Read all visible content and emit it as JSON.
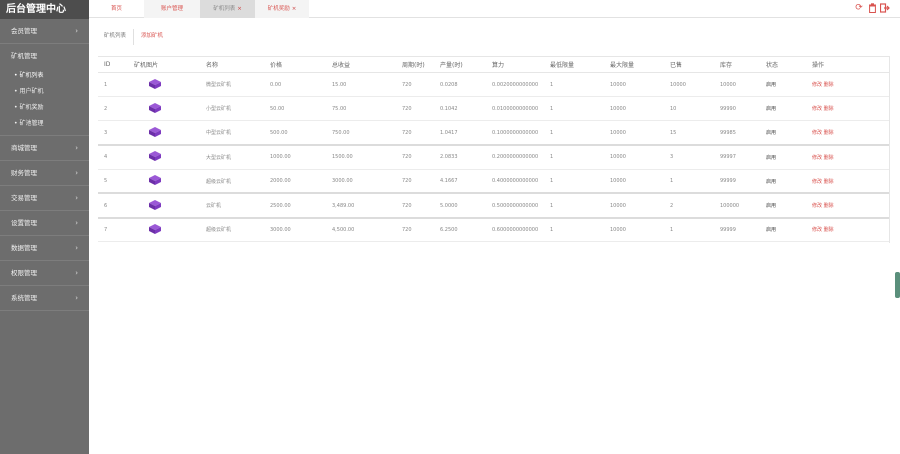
{
  "app": {
    "title": "后台管理中心"
  },
  "sidebar": {
    "groups": [
      {
        "label": "会员管理",
        "expanded": false
      },
      {
        "label": "矿机管理",
        "expanded": true,
        "items": [
          {
            "label": "矿机列表"
          },
          {
            "label": "用户矿机"
          },
          {
            "label": "矿机奖励"
          },
          {
            "label": "矿池管理"
          }
        ]
      },
      {
        "label": "商城管理",
        "expanded": false
      },
      {
        "label": "财务管理",
        "expanded": false
      },
      {
        "label": "交易管理",
        "expanded": false
      },
      {
        "label": "设置管理",
        "expanded": false
      },
      {
        "label": "数据管理",
        "expanded": false
      },
      {
        "label": "权限管理",
        "expanded": false
      },
      {
        "label": "系统管理",
        "expanded": false
      }
    ]
  },
  "topbar": {
    "tabs": [
      {
        "label": "首页"
      },
      {
        "label": "账户管理"
      },
      {
        "label": "矿机列表",
        "close": "×"
      },
      {
        "label": "矿机奖励",
        "close": "×"
      }
    ]
  },
  "subtabs": {
    "list": "矿机列表",
    "add": "添加矿机"
  },
  "table": {
    "headers": [
      "ID",
      "矿机图片",
      "名称",
      "价格",
      "总收益",
      "周期(时)",
      "产量(时)",
      "算力",
      "最低限量",
      "最大限量",
      "已售",
      "库存",
      "状态",
      "操作"
    ],
    "rows": [
      {
        "id": "1",
        "name": "微型云矿机",
        "price": "0.00",
        "revenue": "15.00",
        "cycle": "720",
        "output": "0.0208",
        "power": "0.0020000000000",
        "min": "1",
        "max": "10000",
        "sold": "10000",
        "stock": "10000",
        "status": "启用",
        "action": "修改 删除"
      },
      {
        "id": "2",
        "name": "小型云矿机",
        "price": "50.00",
        "revenue": "75.00",
        "cycle": "720",
        "output": "0.1042",
        "power": "0.0100000000000",
        "min": "1",
        "max": "10000",
        "sold": "10",
        "stock": "99990",
        "status": "启用",
        "action": "修改 删除"
      },
      {
        "id": "3",
        "name": "中型云矿机",
        "price": "500.00",
        "revenue": "750.00",
        "cycle": "720",
        "output": "1.0417",
        "power": "0.1000000000000",
        "min": "1",
        "max": "10000",
        "sold": "15",
        "stock": "99985",
        "status": "启用",
        "action": "修改 删除"
      },
      {
        "id": "4",
        "name": "大型云矿机",
        "price": "1000.00",
        "revenue": "1500.00",
        "cycle": "720",
        "output": "2.0833",
        "power": "0.2000000000000",
        "min": "1",
        "max": "10000",
        "sold": "3",
        "stock": "99997",
        "status": "启用",
        "action": "修改 删除"
      },
      {
        "id": "5",
        "name": "超级云矿机",
        "price": "2000.00",
        "revenue": "3000.00",
        "cycle": "720",
        "output": "4.1667",
        "power": "0.4000000000000",
        "min": "1",
        "max": "10000",
        "sold": "1",
        "stock": "99999",
        "status": "启用",
        "action": "修改 删除"
      },
      {
        "id": "6",
        "name": "云矿机",
        "price": "2500.00",
        "revenue": "3,489.00",
        "cycle": "720",
        "output": "5.0000",
        "power": "0.5000000000000",
        "min": "1",
        "max": "10000",
        "sold": "2",
        "stock": "100000",
        "status": "启用",
        "action": "修改 删除"
      },
      {
        "id": "7",
        "name": "超级云矿机",
        "price": "3000.00",
        "revenue": "4,500.00",
        "cycle": "720",
        "output": "6.2500",
        "power": "0.6000000000000",
        "min": "1",
        "max": "10000",
        "sold": "1",
        "stock": "99999",
        "status": "启用",
        "action": "修改 删除"
      }
    ]
  },
  "colors": {
    "sidebar_bg": "#6d6d6d",
    "brand_bg": "#4d4d4d",
    "accent": "#d9534f"
  },
  "icons": {
    "refresh": "refresh-icon",
    "trash": "trash-icon",
    "logout": "logout-icon",
    "chevron": "chevron-right-icon",
    "product": "miner-image"
  }
}
